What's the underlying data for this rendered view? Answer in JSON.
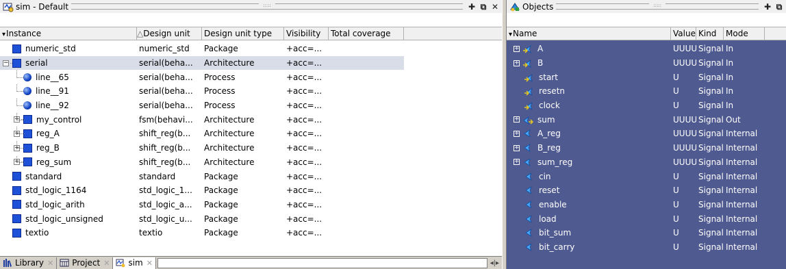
{
  "sim_panel": {
    "title": "sim - Default",
    "columns": [
      "Instance",
      "Design unit",
      "Design unit type",
      "Visibility",
      "Total coverage"
    ],
    "rows": [
      {
        "name": "numeric_std",
        "unit": "numeric_std",
        "type": "Package",
        "vis": "+acc=...",
        "level": 0,
        "icon": "package-icon",
        "expander": "",
        "selected": false
      },
      {
        "name": "serial",
        "unit": "serial(beha...",
        "type": "Architecture",
        "vis": "+acc=...",
        "level": 0,
        "icon": "architecture-icon",
        "expander": "-",
        "selected": true
      },
      {
        "name": "line__65",
        "unit": "serial(beha...",
        "type": "Process",
        "vis": "+acc=...",
        "level": 1,
        "icon": "process-icon",
        "expander": "",
        "selected": false
      },
      {
        "name": "line__91",
        "unit": "serial(beha...",
        "type": "Process",
        "vis": "+acc=...",
        "level": 1,
        "icon": "process-icon",
        "expander": "",
        "selected": false
      },
      {
        "name": "line__92",
        "unit": "serial(beha...",
        "type": "Process",
        "vis": "+acc=...",
        "level": 1,
        "icon": "process-icon",
        "expander": "",
        "selected": false
      },
      {
        "name": "my_control",
        "unit": "fsm(behavi...",
        "type": "Architecture",
        "vis": "+acc=...",
        "level": 1,
        "icon": "architecture-icon",
        "expander": "+",
        "selected": false
      },
      {
        "name": "reg_A",
        "unit": "shift_reg(b...",
        "type": "Architecture",
        "vis": "+acc=...",
        "level": 1,
        "icon": "architecture-icon",
        "expander": "+",
        "selected": false
      },
      {
        "name": "reg_B",
        "unit": "shift_reg(b...",
        "type": "Architecture",
        "vis": "+acc=...",
        "level": 1,
        "icon": "architecture-icon",
        "expander": "+",
        "selected": false
      },
      {
        "name": "reg_sum",
        "unit": "shift_reg(b...",
        "type": "Architecture",
        "vis": "+acc=...",
        "level": 1,
        "icon": "architecture-icon",
        "expander": "+",
        "selected": false
      },
      {
        "name": "standard",
        "unit": "standard",
        "type": "Package",
        "vis": "+acc=...",
        "level": 0,
        "icon": "package-icon",
        "expander": "",
        "selected": false
      },
      {
        "name": "std_logic_1164",
        "unit": "std_logic_1...",
        "type": "Package",
        "vis": "+acc=...",
        "level": 0,
        "icon": "package-icon",
        "expander": "",
        "selected": false
      },
      {
        "name": "std_logic_arith",
        "unit": "std_logic_a...",
        "type": "Package",
        "vis": "+acc=...",
        "level": 0,
        "icon": "package-icon",
        "expander": "",
        "selected": false
      },
      {
        "name": "std_logic_unsigned",
        "unit": "std_logic_u...",
        "type": "Package",
        "vis": "+acc=...",
        "level": 0,
        "icon": "package-icon",
        "expander": "",
        "selected": false
      },
      {
        "name": "textio",
        "unit": "textio",
        "type": "Package",
        "vis": "+acc=...",
        "level": 0,
        "icon": "package-icon",
        "expander": "",
        "selected": false
      }
    ],
    "tabs": [
      {
        "label": "Library",
        "active": false,
        "icon": "library-icon"
      },
      {
        "label": "Project",
        "active": false,
        "icon": "project-icon"
      },
      {
        "label": "sim",
        "active": true,
        "icon": "sim-icon"
      }
    ],
    "sort_arrow": "△"
  },
  "objects_panel": {
    "title": "Objects",
    "columns": [
      "Name",
      "Value",
      "Kind",
      "Mode"
    ],
    "rows": [
      {
        "name": "A",
        "value": "UUUU...",
        "kind": "Signal",
        "mode": "In",
        "expander": "+",
        "dir": "in"
      },
      {
        "name": "B",
        "value": "UUUU...",
        "kind": "Signal",
        "mode": "In",
        "expander": "+",
        "dir": "in"
      },
      {
        "name": "start",
        "value": "U",
        "kind": "Signal",
        "mode": "In",
        "expander": "",
        "dir": "in"
      },
      {
        "name": "resetn",
        "value": "U",
        "kind": "Signal",
        "mode": "In",
        "expander": "",
        "dir": "in"
      },
      {
        "name": "clock",
        "value": "U",
        "kind": "Signal",
        "mode": "In",
        "expander": "",
        "dir": "in"
      },
      {
        "name": "sum",
        "value": "UUUU...",
        "kind": "Signal",
        "mode": "Out",
        "expander": "+",
        "dir": "out"
      },
      {
        "name": "A_reg",
        "value": "UUUU...",
        "kind": "Signal",
        "mode": "Internal",
        "expander": "+",
        "dir": "internal"
      },
      {
        "name": "B_reg",
        "value": "UUUU...",
        "kind": "Signal",
        "mode": "Internal",
        "expander": "+",
        "dir": "internal"
      },
      {
        "name": "sum_reg",
        "value": "UUUU...",
        "kind": "Signal",
        "mode": "Internal",
        "expander": "+",
        "dir": "internal"
      },
      {
        "name": "cin",
        "value": "U",
        "kind": "Signal",
        "mode": "Internal",
        "expander": "",
        "dir": "internal"
      },
      {
        "name": "reset",
        "value": "U",
        "kind": "Signal",
        "mode": "Internal",
        "expander": "",
        "dir": "internal"
      },
      {
        "name": "enable",
        "value": "U",
        "kind": "Signal",
        "mode": "Internal",
        "expander": "",
        "dir": "internal"
      },
      {
        "name": "load",
        "value": "U",
        "kind": "Signal",
        "mode": "Internal",
        "expander": "",
        "dir": "internal"
      },
      {
        "name": "bit_sum",
        "value": "U",
        "kind": "Signal",
        "mode": "Internal",
        "expander": "",
        "dir": "internal"
      },
      {
        "name": "bit_carry",
        "value": "U",
        "kind": "Signal",
        "mode": "Internal",
        "expander": "",
        "dir": "internal"
      }
    ]
  },
  "colors": {
    "objects_bg": "#4f5a91",
    "selected_row": "#d8dde8",
    "instance_icon": "#1e50d8"
  }
}
